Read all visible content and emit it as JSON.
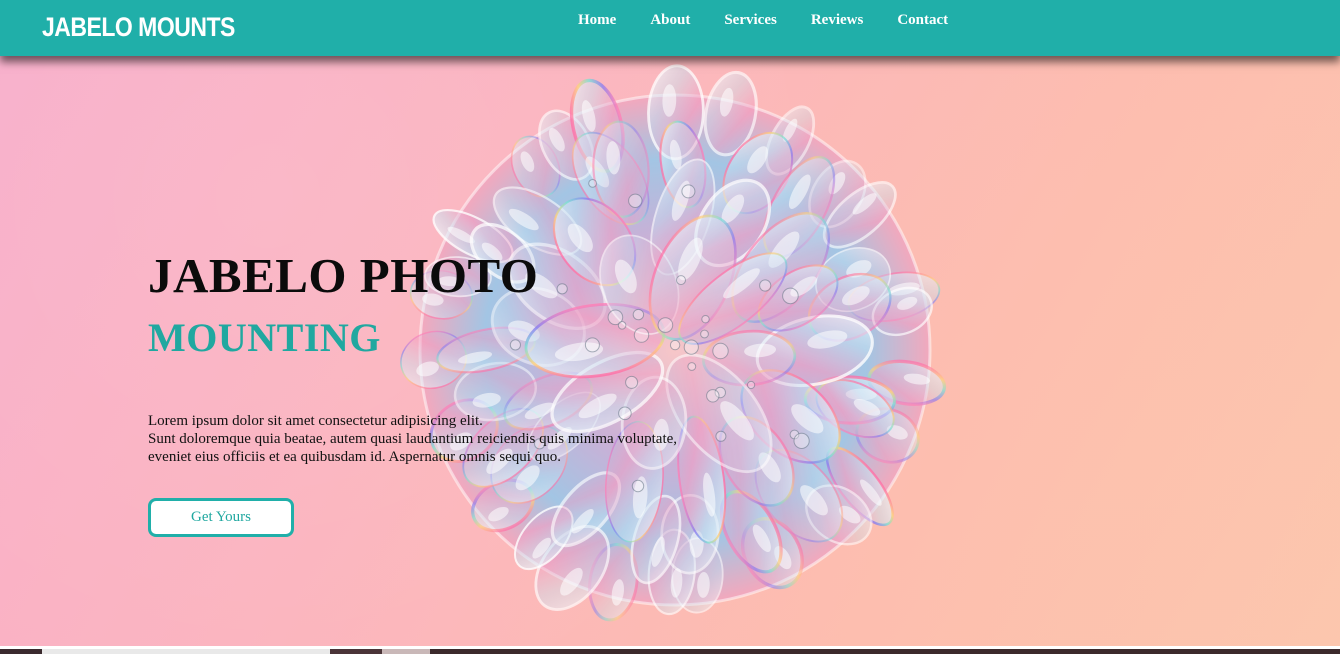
{
  "brand": {
    "name": "JABELO MOUNTS"
  },
  "nav": {
    "items": [
      {
        "label": "Home"
      },
      {
        "label": "About"
      },
      {
        "label": "Services"
      },
      {
        "label": "Reviews"
      },
      {
        "label": "Contact"
      }
    ]
  },
  "hero": {
    "title": "JABELO PHOTO",
    "subtitle": "MOUNTING",
    "description_lines": [
      "Lorem ipsum dolor sit amet consectetur adipisicing elit.",
      "Sunt doloremque quia beatae, autem quasi laudantium reiciendis quis minima voluptate,",
      "eveniet eius officiis et ea quibusdam id. Aspernatur omnis sequi quo."
    ],
    "cta_label": "Get Yours"
  },
  "colors": {
    "accent": "#20afa9",
    "accent_text": "#20a8a0",
    "title_text": "#0b0b0b",
    "background_from": "#f8aecb",
    "background_to": "#fcc6ae"
  },
  "icons": {
    "hero_image": "glass-bubble-orb"
  }
}
